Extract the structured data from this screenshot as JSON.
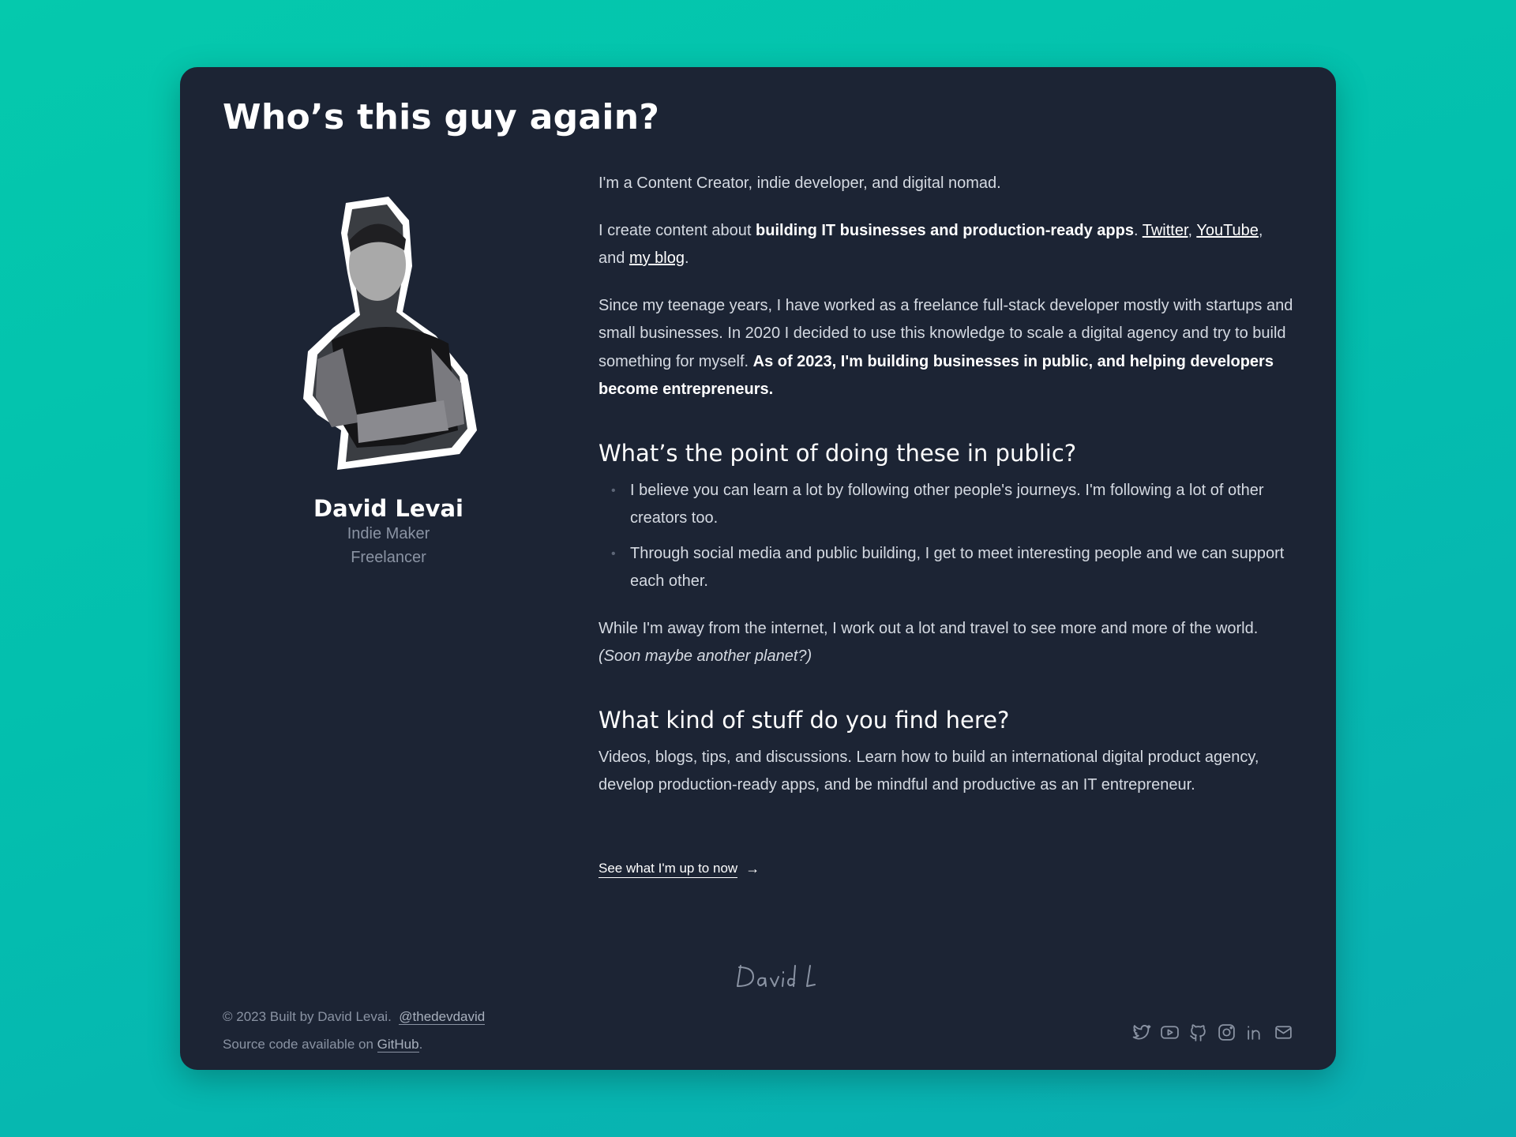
{
  "page": {
    "title": "Who’s this guy again?"
  },
  "profile": {
    "name": "David Levai",
    "roles": [
      "Indie Maker",
      "Freelancer"
    ]
  },
  "intro": {
    "p1": "I'm a Content Creator, indie developer, and digital nomad.",
    "p2_pre": "I create content about ",
    "p2_bold": "building IT businesses and production-ready apps",
    "p2_sep1": ". ",
    "twitter": "Twitter",
    "p2_sep2": ", ",
    "youtube": "YouTube",
    "p2_sep3": ", and ",
    "blog": "my blog",
    "p2_end": ".",
    "p3_text": "Since my teenage years, I have worked as a freelance full-stack developer mostly with startups and small businesses. In 2020 I decided to use this knowledge to scale a digital agency and try to build something for myself. ",
    "p3_bold": "As of 2023, I'm building businesses in public, and helping developers become entrepreneurs."
  },
  "section_public": {
    "heading": "What’s the point of doing these in public?",
    "items": [
      "I believe you can learn a lot by following other people's journeys. I'm following a lot of other creators too.",
      "Through social media and public building, I get to meet interesting people and we can support each other."
    ],
    "away_text": "While I'm away from the internet, I work out a lot and travel to see more and more of the world. ",
    "away_italic": "(Soon maybe another planet?)"
  },
  "section_stuff": {
    "heading": "What kind of stuff do you find here?",
    "text": "Videos, blogs, tips, and discussions. Learn how to build an international digital product agency, develop production-ready apps, and be mindful and productive as an IT entrepreneur."
  },
  "cta": {
    "label": "See what I'm up to now",
    "arrow": "→"
  },
  "signature": "David L",
  "footer": {
    "copyright": "© 2023 Built by David Levai.",
    "handle": "@thedevdavid",
    "source_pre": "Source code available on ",
    "source_link": "GitHub",
    "source_end": "."
  },
  "socials": [
    "twitter-icon",
    "youtube-icon",
    "github-icon",
    "instagram-icon",
    "linkedin-icon",
    "mail-icon"
  ],
  "colors": {
    "background": "#05c9ad",
    "card": "#1c2434",
    "text": "#d5dae2",
    "muted": "#8a93a3",
    "heading": "#ffffff"
  }
}
